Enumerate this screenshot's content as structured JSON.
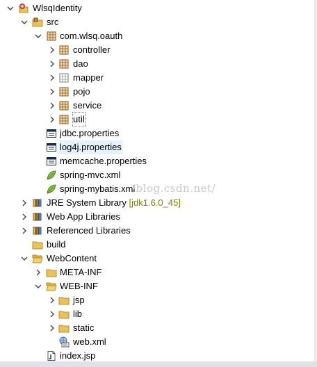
{
  "project": {
    "name": "WlsqIdentity"
  },
  "src": {
    "label": "src"
  },
  "package": {
    "name": "com.wlsq.oauth"
  },
  "subpackages": [
    "controller",
    "dao",
    "mapper",
    "pojo",
    "service",
    "util"
  ],
  "src_files": [
    "jdbc.properties",
    "log4j.properties",
    "memcache.properties",
    "spring-mvc.xml",
    "spring-mybatis.xml"
  ],
  "libraries": {
    "jre": {
      "label": "JRE System Library",
      "decoration": "[jdk1.6.0_45]"
    },
    "webapp": "Web App Libraries",
    "referenced": "Referenced Libraries"
  },
  "build": "build",
  "webcontent": {
    "label": "WebContent",
    "meta_inf": "META-INF",
    "web_inf": "WEB-INF",
    "web_inf_children": [
      "jsp",
      "lib",
      "static"
    ],
    "web_xml": "web.xml",
    "index": "index.jsp"
  },
  "watermark": "/blog.csdn.net/",
  "colors": {
    "folder": "#e8c15a",
    "package": "#c0823e",
    "selection": "#e5f1fb",
    "decoration": "#808000",
    "spring_leaf": "#8bc34a"
  }
}
